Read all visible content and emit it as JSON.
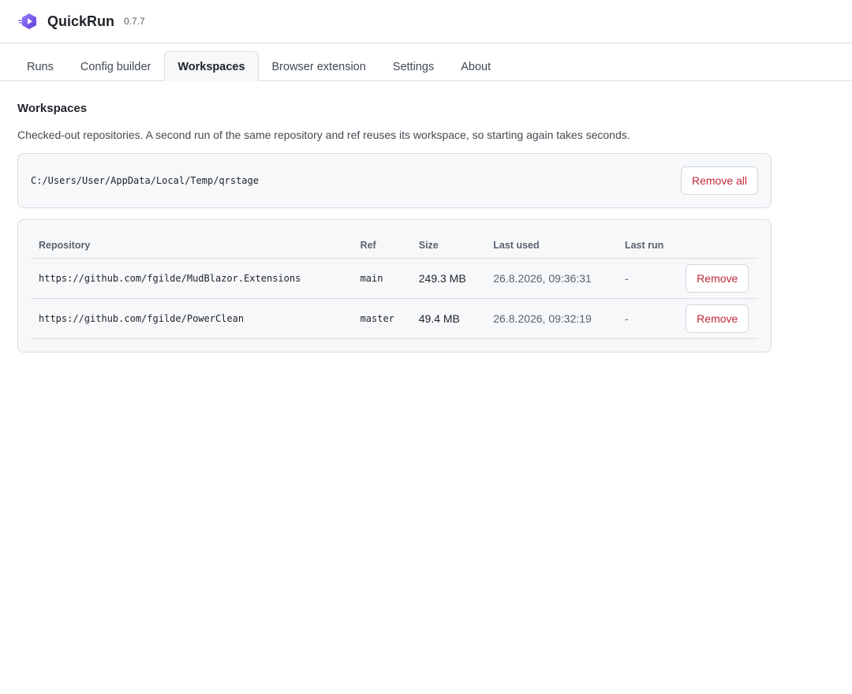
{
  "app": {
    "title": "QuickRun",
    "version": "0.7.7",
    "logo_icon": "quickrun-logo-icon",
    "accent": "#7c5cff"
  },
  "tabs": [
    {
      "label": "Runs",
      "active": false
    },
    {
      "label": "Config builder",
      "active": false
    },
    {
      "label": "Workspaces",
      "active": true
    },
    {
      "label": "Browser extension",
      "active": false
    },
    {
      "label": "Settings",
      "active": false
    },
    {
      "label": "About",
      "active": false
    }
  ],
  "workspaces": {
    "title": "Workspaces",
    "description": "Checked-out repositories. A second run of the same repository and ref reuses its workspace, so starting again takes seconds.",
    "path": "C:/Users/User/AppData/Local/Temp/qrstage",
    "remove_all_label": "Remove all",
    "columns": [
      "Repository",
      "Ref",
      "Size",
      "Last used",
      "Last run"
    ],
    "rows": [
      {
        "repository": "https://github.com/fgilde/MudBlazor.Extensions",
        "ref": "main",
        "size": "249.3 MB",
        "last_used": "26.8.2026, 09:36:31",
        "last_run": "-",
        "remove_label": "Remove"
      },
      {
        "repository": "https://github.com/fgilde/PowerClean",
        "ref": "master",
        "size": "49.4 MB",
        "last_used": "26.8.2026, 09:32:19",
        "last_run": "-",
        "remove_label": "Remove"
      }
    ]
  },
  "colors": {
    "danger_text": "#c0273a",
    "border": "#d9dce1",
    "panel_bg": "#f6f8fa"
  }
}
